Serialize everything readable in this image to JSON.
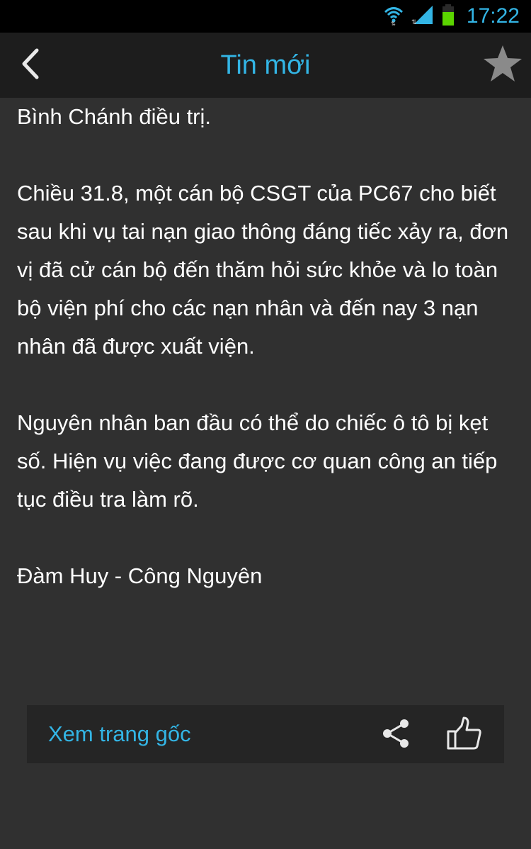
{
  "status_bar": {
    "time": "17:22",
    "icons": [
      "wifi-icon",
      "signal-icon",
      "battery-icon"
    ],
    "time_color": "#33b5e5"
  },
  "action_bar": {
    "title": "Tin mới",
    "back_icon": "chevron-left-icon",
    "star_icon": "star-icon",
    "accent_color": "#33b5e5"
  },
  "article": {
    "paragraphs": [
      "Bình Chánh điều trị.",
      "Chiều 31.8, một cán bộ CSGT của PC67 cho biết sau khi vụ tai nạn giao thông đáng tiếc xảy ra, đơn vị đã cử cán bộ đến thăm hỏi sức khỏe và lo toàn bộ viện phí cho các nạn nhân và đến nay 3 nạn nhân đã được xuất viện.",
      "Nguyên nhân ban đầu có thể do chiếc ô tô bị kẹt số. Hiện vụ việc đang được cơ quan công an tiếp tục điều tra làm rõ.",
      "Đàm Huy - Công Nguyên"
    ]
  },
  "footer": {
    "view_original_label": "Xem trang gốc",
    "share_icon": "share-icon",
    "like_icon": "thumbs-up-icon"
  }
}
